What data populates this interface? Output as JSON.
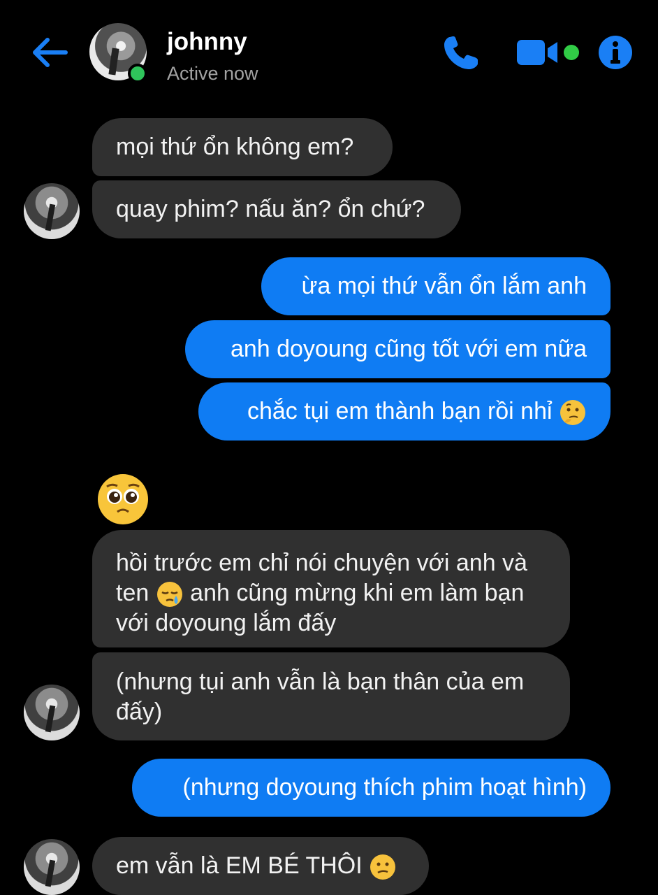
{
  "header": {
    "name": "johnny",
    "status": "Active now",
    "back_icon": "arrow-left-icon",
    "call_icon": "phone-icon",
    "video_icon": "video-camera-icon",
    "info_icon": "info-icon"
  },
  "colors": {
    "accent": "#0f7cf3",
    "received_bubble": "#303030",
    "online": "#2fc45b",
    "background": "#000000"
  },
  "messages": {
    "m1": "mọi thứ ổn không em?",
    "m2": "quay phim? nấu ăn? ổn chứ?",
    "m3": "ừa mọi thứ vẫn ổn lắm anh",
    "m4": "anh doyoung cũng tốt với em nữa",
    "m5": "chắc tụi em thành bạn rồi nhỉ",
    "m5_emoji": "thinking-face-emoji",
    "m6_emoji": "pleading-face-emoji",
    "m7_part1": "hồi trước em chỉ nói chuyện với anh và ten",
    "m7_emoji": "sleepy-face-emoji",
    "m7_part2": "anh cũng mừng khi em làm bạn với doyoung lắm đấy",
    "m8": "(nhưng tụi anh vẫn là bạn thân của em đấy)",
    "m9": "(nhưng doyoung thích phim hoạt hình)",
    "m10": "em vẫn là EM BÉ THÔI",
    "m10_emoji": "confused-face-emoji"
  }
}
